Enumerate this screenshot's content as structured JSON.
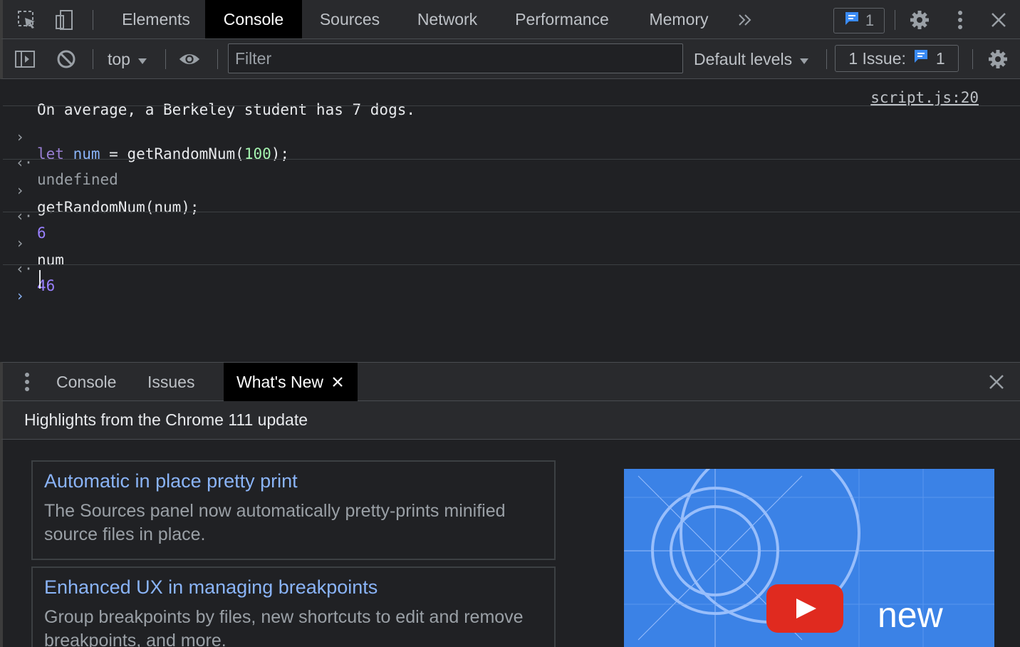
{
  "topbar": {
    "tabs": [
      {
        "label": "Elements",
        "active": false
      },
      {
        "label": "Console",
        "active": true
      },
      {
        "label": "Sources",
        "active": false
      },
      {
        "label": "Network",
        "active": false
      },
      {
        "label": "Performance",
        "active": false
      },
      {
        "label": "Memory",
        "active": false
      }
    ],
    "issue_count": "1"
  },
  "toolbar": {
    "context": "top",
    "filter_placeholder": "Filter",
    "levels": "Default levels",
    "issues_label": "1 Issue:",
    "issues_count": "1"
  },
  "console": {
    "log_message": "On average, a Berkeley student has 7 dogs.",
    "log_source": "script.js:20",
    "entries": [
      {
        "input_kw": "let",
        "input_var": "num",
        "input_mid": " = getRandomNum(",
        "input_num": "100",
        "input_end": ");",
        "result": "undefined"
      },
      {
        "input": "getRandomNum(num);",
        "result": "6"
      },
      {
        "input": "num",
        "result": "46"
      }
    ]
  },
  "drawer": {
    "tabs": [
      "Console",
      "Issues",
      "What's New"
    ],
    "heading": "Highlights from the Chrome 111 update",
    "cards": [
      {
        "title": "Automatic in place pretty print",
        "body": "The Sources panel now automatically pretty-prints minified source files in place."
      },
      {
        "title": "Enhanced UX in managing breakpoints",
        "body": "Group breakpoints by files, new shortcuts to edit and remove breakpoints, and more."
      }
    ],
    "video_text": "new"
  },
  "colors": {
    "link": "#8ab4f8",
    "background": "#202124",
    "toolbar": "#292a2d",
    "badge_blue": "#3a8bf5",
    "video_bg": "#3b82e6",
    "play_red": "#e02a1f"
  },
  "icons": [
    "select-element-icon",
    "device-toggle-icon",
    "more-tabs-icon",
    "message-icon",
    "settings-gear-icon",
    "kebab-menu-icon",
    "close-icon",
    "sidebar-toggle-icon",
    "clear-console-icon",
    "eye-icon",
    "play-icon"
  ]
}
